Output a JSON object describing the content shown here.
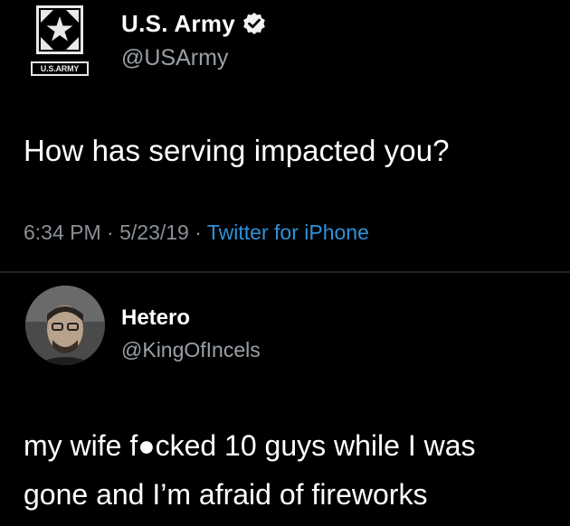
{
  "tweet": {
    "logo_label": "U.S.ARMY",
    "display_name": "U.S. Army",
    "handle": "@USArmy",
    "text": "How has serving impacted you?",
    "time": "6:34 PM",
    "date": "5/23/19",
    "separator": "·",
    "source": "Twitter for iPhone",
    "verified": true
  },
  "reply": {
    "display_name": "Hetero",
    "handle": "@KingOfIncels",
    "text_line1": "my wife f●cked 10 guys while I was",
    "text_line2": "gone and I’m afraid of fireworks"
  },
  "colors": {
    "background": "#000000",
    "text": "#ffffff",
    "muted": "#8a9096",
    "link": "#2f91d8"
  },
  "icons": {
    "logo": "army-star-logo-icon",
    "verified": "verified-badge-icon",
    "avatar": "user-avatar"
  }
}
